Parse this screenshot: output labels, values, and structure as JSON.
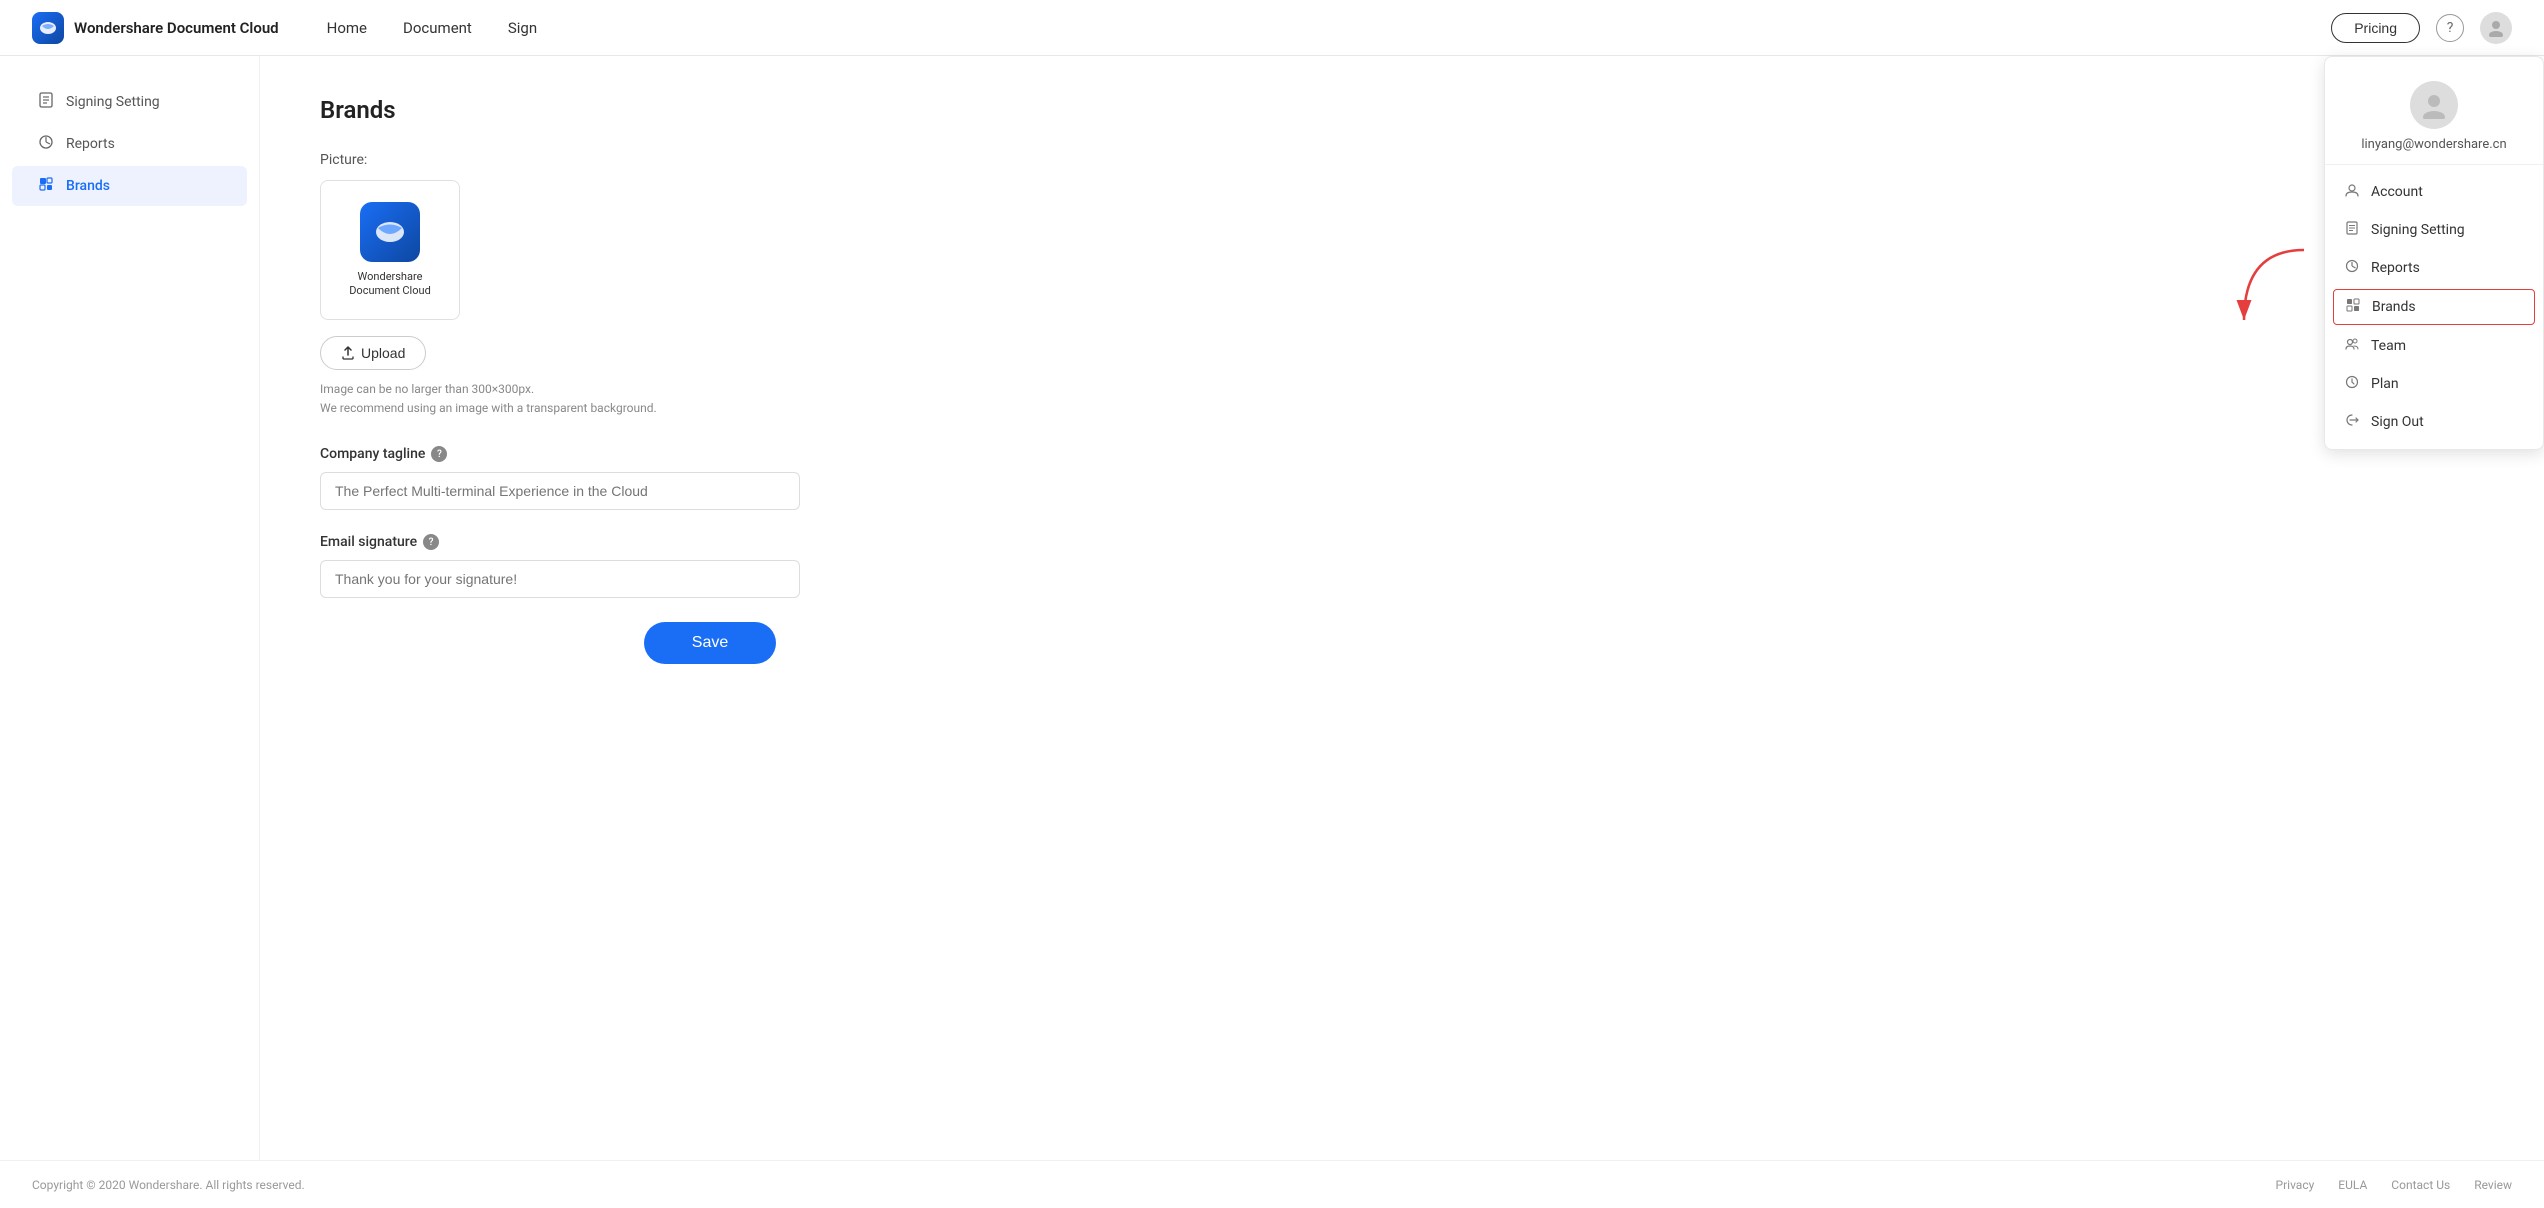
{
  "header": {
    "logo_text": "Wondershare Document Cloud",
    "nav": [
      "Home",
      "Document",
      "Sign"
    ],
    "pricing_label": "Pricing",
    "help_icon": "?",
    "avatar_icon": "👤"
  },
  "sidebar": {
    "items": [
      {
        "id": "signing-setting",
        "label": "Signing Setting",
        "icon": "📄",
        "active": false
      },
      {
        "id": "reports",
        "label": "Reports",
        "icon": "🕐",
        "active": false
      },
      {
        "id": "brands",
        "label": "Brands",
        "icon": "🏷️",
        "active": true
      }
    ]
  },
  "content": {
    "title": "Brands",
    "picture_label": "Picture:",
    "brand_logo_text": "Wondershare\nDocument Cloud",
    "upload_label": "Upload",
    "image_hint_line1": "Image can be no larger than 300×300px.",
    "image_hint_line2": "We recommend using an image with a transparent background.",
    "company_tagline_label": "Company tagline",
    "company_tagline_placeholder": "The Perfect Multi-terminal Experience in the Cloud",
    "email_signature_label": "Email signature",
    "email_signature_placeholder": "Thank you for your signature!",
    "save_label": "Save"
  },
  "dropdown": {
    "email": "linyang@wondershare.cn",
    "items": [
      {
        "id": "account",
        "label": "Account",
        "icon": "👤"
      },
      {
        "id": "signing-setting",
        "label": "Signing Setting",
        "icon": "📄"
      },
      {
        "id": "reports",
        "label": "Reports",
        "icon": "🕐"
      },
      {
        "id": "brands",
        "label": "Brands",
        "icon": "🏷️",
        "active": true
      },
      {
        "id": "team",
        "label": "Team",
        "icon": "👥"
      },
      {
        "id": "plan",
        "label": "Plan",
        "icon": "🎁"
      },
      {
        "id": "sign-out",
        "label": "Sign Out",
        "icon": "⏻"
      }
    ]
  },
  "footer": {
    "copyright": "Copyright © 2020 Wondershare. All rights reserved.",
    "links": [
      "Privacy",
      "EULA",
      "Contact Us",
      "Review"
    ]
  }
}
